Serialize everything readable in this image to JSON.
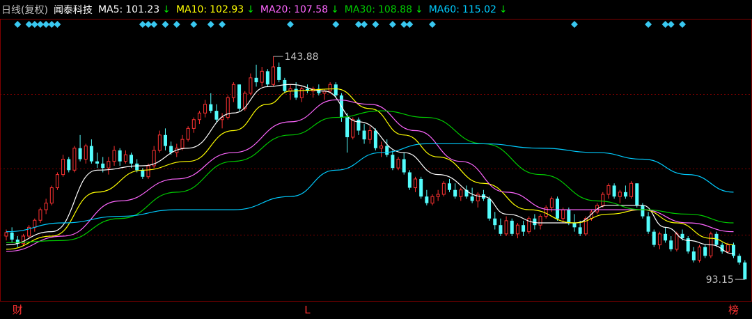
{
  "header": {
    "period": "日线(复权)",
    "name": "闻泰科技",
    "ma": [
      {
        "label": "MA5:",
        "value": "101.23",
        "arrow": "↓",
        "color": "#ffffff"
      },
      {
        "label": "MA10:",
        "value": "102.93",
        "arrow": "↓",
        "color": "#ffff00"
      },
      {
        "label": "MA20:",
        "value": "107.58",
        "arrow": "↓",
        "color": "#ff66ff"
      },
      {
        "label": "MA30:",
        "value": "108.88",
        "arrow": "↓",
        "color": "#00cc00"
      },
      {
        "label": "MA60:",
        "value": "115.02",
        "arrow": "↓",
        "color": "#00ccff"
      }
    ]
  },
  "colors": {
    "up": "#ff3232",
    "down": "#54fcfc",
    "grid": "#800000",
    "text": "#c0c0c0",
    "marker": "#39c8f0",
    "tag": "#ff3232"
  },
  "chart_data": {
    "type": "candlestick",
    "ylim": [
      90,
      148
    ],
    "high_label": "143.88",
    "low_label": "93.15",
    "candles": [
      [
        103,
        104.5,
        102,
        103.8
      ],
      [
        103.8,
        105,
        101.5,
        102.2
      ],
      [
        102.2,
        103,
        100.5,
        101.3
      ],
      [
        101.3,
        103.5,
        100.8,
        103
      ],
      [
        103,
        105.5,
        102.5,
        105
      ],
      [
        105,
        107,
        104,
        106.6
      ],
      [
        106.6,
        109.5,
        106,
        109
      ],
      [
        109,
        111.5,
        108,
        110.5
      ],
      [
        110.5,
        114.5,
        110,
        114
      ],
      [
        114,
        117.5,
        113.5,
        117
      ],
      [
        117,
        121.5,
        116.5,
        120.5
      ],
      [
        120.5,
        121,
        117.5,
        118
      ],
      [
        118,
        123.5,
        117.5,
        123
      ],
      [
        123,
        126,
        120,
        120.5
      ],
      [
        120.5,
        124,
        119.5,
        123.5
      ],
      [
        123.5,
        125,
        119.5,
        120
      ],
      [
        120,
        122,
        118.5,
        119.5
      ],
      [
        119.5,
        121,
        117.5,
        118.5
      ],
      [
        118.5,
        121,
        117,
        120
      ],
      [
        120,
        123.5,
        119,
        122.5
      ],
      [
        122.5,
        123,
        119,
        120
      ],
      [
        120,
        122.5,
        119.5,
        121.5
      ],
      [
        121.5,
        122,
        118.5,
        119.5
      ],
      [
        119.5,
        120.5,
        117.5,
        118
      ],
      [
        118,
        118.5,
        116,
        116.5
      ],
      [
        116.5,
        119.5,
        116,
        119
      ],
      [
        119,
        123.5,
        118.5,
        122.5
      ],
      [
        122.5,
        127,
        122,
        126
      ],
      [
        126,
        127.5,
        122.5,
        123.5
      ],
      [
        123.5,
        124.5,
        121.5,
        122
      ],
      [
        122,
        124,
        121,
        123
      ],
      [
        123,
        126,
        122.5,
        125
      ],
      [
        125,
        128,
        124.5,
        127.5
      ],
      [
        127.5,
        130,
        126.5,
        129.5
      ],
      [
        129.5,
        131.5,
        128.5,
        131
      ],
      [
        131,
        134,
        130,
        133
      ],
      [
        133,
        135.5,
        131,
        131.5
      ],
      [
        131.5,
        133,
        129,
        129.5
      ],
      [
        129.5,
        131,
        127.5,
        130
      ],
      [
        130,
        135,
        129.5,
        134.5
      ],
      [
        134.5,
        138,
        133.5,
        137.5
      ],
      [
        137.5,
        137.5,
        131.5,
        132
      ],
      [
        132,
        136,
        131.5,
        135.5
      ],
      [
        135.5,
        140,
        135,
        139
      ],
      [
        139,
        142,
        137,
        138
      ],
      [
        138,
        141.5,
        137,
        140.5
      ],
      [
        140.5,
        141,
        137,
        137.5
      ],
      [
        137.5,
        143.88,
        137,
        141.5
      ],
      [
        141.5,
        142.5,
        138,
        138.5
      ],
      [
        138.5,
        139,
        135.5,
        136
      ],
      [
        136,
        137.5,
        134,
        136.5
      ],
      [
        136.5,
        138,
        134,
        134.5
      ],
      [
        134.5,
        137,
        133.5,
        136.5
      ],
      [
        136.5,
        137.5,
        135.5,
        136
      ],
      [
        136,
        137,
        134.5,
        136.5
      ],
      [
        136.5,
        137.5,
        135,
        135.5
      ],
      [
        135.5,
        136.5,
        134,
        136
      ],
      [
        136,
        138,
        135.5,
        137.5
      ],
      [
        137.5,
        138,
        134.5,
        135
      ],
      [
        135,
        135.5,
        129,
        130
      ],
      [
        130,
        131,
        122,
        125.5
      ],
      [
        125.5,
        130,
        125,
        129.5
      ],
      [
        129.5,
        130,
        126,
        127
      ],
      [
        127,
        128.5,
        124,
        125
      ],
      [
        125,
        128,
        124,
        127
      ],
      [
        127,
        127.5,
        122.5,
        123
      ],
      [
        123,
        124.5,
        121,
        123.5
      ],
      [
        123.5,
        125,
        121,
        121.5
      ],
      [
        121.5,
        122.5,
        118,
        118.5
      ],
      [
        118.5,
        121,
        118,
        120.5
      ],
      [
        120.5,
        122,
        117,
        117.5
      ],
      [
        117.5,
        118,
        113.5,
        114
      ],
      [
        114,
        116.5,
        113,
        116
      ],
      [
        116,
        116.5,
        111.5,
        112
      ],
      [
        112,
        113.5,
        110,
        110.5
      ],
      [
        110.5,
        112.5,
        110,
        112
      ],
      [
        112,
        113.5,
        111,
        112.5
      ],
      [
        112.5,
        115.5,
        112,
        115
      ],
      [
        115,
        116,
        113,
        113.5
      ],
      [
        113.5,
        115,
        111.5,
        112
      ],
      [
        112,
        114,
        111,
        113.5
      ],
      [
        113.5,
        114.5,
        111.5,
        112
      ],
      [
        112,
        114,
        110.5,
        111
      ],
      [
        111,
        113,
        109.5,
        112.5
      ],
      [
        112.5,
        113.5,
        111,
        111.5
      ],
      [
        111.5,
        112,
        106.5,
        107
      ],
      [
        107,
        108.5,
        104.5,
        105.5
      ],
      [
        105.5,
        107,
        103,
        103.5
      ],
      [
        103.5,
        107.5,
        103,
        106.5
      ],
      [
        106.5,
        107,
        103,
        103.5
      ],
      [
        103.5,
        106,
        102.5,
        105.5
      ],
      [
        105.5,
        106.5,
        103,
        104
      ],
      [
        104,
        107.5,
        103.5,
        107
      ],
      [
        107,
        108,
        104.5,
        105.5
      ],
      [
        105.5,
        108,
        104.5,
        107.5
      ],
      [
        107.5,
        110,
        107,
        109.5
      ],
      [
        109.5,
        112,
        108.5,
        111.5
      ],
      [
        111.5,
        112,
        106.5,
        107
      ],
      [
        107,
        109.5,
        106,
        109
      ],
      [
        109,
        109.5,
        105.5,
        106
      ],
      [
        106,
        108,
        104,
        105
      ],
      [
        105,
        106.5,
        103,
        103.5
      ],
      [
        103.5,
        107.5,
        103,
        107
      ],
      [
        107,
        109,
        106.5,
        108.5
      ],
      [
        108.5,
        110.5,
        108,
        110
      ],
      [
        110,
        113,
        109.5,
        112.5
      ],
      [
        112.5,
        115,
        111.5,
        114.5
      ],
      [
        114.5,
        115,
        111.5,
        112
      ],
      [
        112,
        113.5,
        110.5,
        113
      ],
      [
        113,
        114.5,
        111.5,
        112
      ],
      [
        112,
        115.5,
        111.5,
        115
      ],
      [
        115,
        115,
        109.5,
        110
      ],
      [
        110,
        110.5,
        107,
        107.5
      ],
      [
        107.5,
        108.5,
        103.5,
        104
      ],
      [
        104,
        104.5,
        100.5,
        101
      ],
      [
        101,
        104,
        100,
        103.5
      ],
      [
        103.5,
        105,
        101.5,
        102
      ],
      [
        102,
        103,
        99.5,
        100
      ],
      [
        100,
        104,
        99.5,
        103.5
      ],
      [
        103.5,
        104.5,
        102,
        102.5
      ],
      [
        102.5,
        103,
        99,
        99.5
      ],
      [
        99.5,
        100.5,
        97,
        97.5
      ],
      [
        97.5,
        101,
        97,
        100.5
      ],
      [
        100.5,
        101,
        98,
        98.5
      ],
      [
        98.5,
        104,
        98,
        103.5
      ],
      [
        103.5,
        104,
        100.5,
        101
      ],
      [
        101,
        101.5,
        99,
        99.5
      ],
      [
        99.5,
        101.5,
        99,
        101
      ],
      [
        101,
        101.5,
        98,
        98.5
      ],
      [
        98.5,
        99,
        96.5,
        97
      ],
      [
        97,
        97.5,
        93.15,
        93.15
      ]
    ],
    "ma_series": [
      {
        "name": "MA5",
        "color": "#ffffff",
        "values": [
          [
            0,
            101
          ],
          [
            8,
            104
          ],
          [
            16,
            118
          ],
          [
            24,
            119
          ],
          [
            32,
            123
          ],
          [
            40,
            131
          ],
          [
            46,
            137
          ],
          [
            50,
            137.5
          ],
          [
            56,
            136
          ],
          [
            62,
            129
          ],
          [
            70,
            122
          ],
          [
            76,
            117
          ],
          [
            84,
            112
          ],
          [
            88,
            108
          ],
          [
            94,
            106
          ],
          [
            100,
            106
          ],
          [
            106,
            110
          ],
          [
            112,
            110
          ],
          [
            116,
            105
          ],
          [
            120,
            102
          ],
          [
            124,
            101
          ],
          [
            128,
            99
          ]
        ]
      },
      {
        "name": "MA10",
        "color": "#ffff00",
        "values": [
          [
            0,
            100
          ],
          [
            8,
            103
          ],
          [
            16,
            113
          ],
          [
            24,
            118
          ],
          [
            32,
            120
          ],
          [
            40,
            127
          ],
          [
            46,
            133
          ],
          [
            50,
            136
          ],
          [
            58,
            136.5
          ],
          [
            64,
            132
          ],
          [
            70,
            126
          ],
          [
            76,
            121
          ],
          [
            84,
            115
          ],
          [
            92,
            109
          ],
          [
            100,
            106
          ],
          [
            106,
            108
          ],
          [
            112,
            109
          ],
          [
            118,
            106
          ],
          [
            124,
            102.5
          ],
          [
            128,
            101
          ]
        ]
      },
      {
        "name": "MA20",
        "color": "#ff66ff",
        "values": [
          [
            0,
            99.5
          ],
          [
            10,
            103
          ],
          [
            20,
            111
          ],
          [
            30,
            116
          ],
          [
            40,
            122
          ],
          [
            50,
            129
          ],
          [
            58,
            134
          ],
          [
            64,
            133
          ],
          [
            72,
            127
          ],
          [
            80,
            120
          ],
          [
            88,
            113
          ],
          [
            96,
            109
          ],
          [
            104,
            109
          ],
          [
            112,
            109
          ],
          [
            120,
            106
          ],
          [
            128,
            104
          ]
        ]
      },
      {
        "name": "MA30",
        "color": "#00cc00",
        "values": [
          [
            0,
            101.5
          ],
          [
            10,
            102
          ],
          [
            20,
            107
          ],
          [
            30,
            113
          ],
          [
            40,
            120
          ],
          [
            50,
            126
          ],
          [
            58,
            130
          ],
          [
            66,
            131.5
          ],
          [
            74,
            130
          ],
          [
            84,
            124
          ],
          [
            94,
            117
          ],
          [
            104,
            111
          ],
          [
            112,
            109
          ],
          [
            120,
            108
          ],
          [
            128,
            106
          ]
        ]
      },
      {
        "name": "MA60",
        "color": "#00ccff",
        "values": [
          [
            0,
            104
          ],
          [
            10,
            106
          ],
          [
            20,
            107.5
          ],
          [
            30,
            109
          ],
          [
            40,
            109
          ],
          [
            50,
            112
          ],
          [
            58,
            118
          ],
          [
            66,
            122
          ],
          [
            74,
            124
          ],
          [
            84,
            124
          ],
          [
            94,
            123
          ],
          [
            104,
            122
          ],
          [
            112,
            120.5
          ],
          [
            120,
            117
          ],
          [
            128,
            113
          ]
        ]
      }
    ],
    "markers": [
      2,
      4,
      5,
      6,
      7,
      8,
      9,
      24,
      25,
      26,
      28,
      30,
      33,
      36,
      38,
      50,
      58,
      62,
      63,
      65,
      68,
      70,
      71,
      75,
      100,
      113,
      116,
      117,
      119
    ],
    "bottom_tags": [
      {
        "text": "财",
        "index": 2
      },
      {
        "text": "L",
        "index": 53
      },
      {
        "text": "榜",
        "index": 128
      }
    ]
  }
}
